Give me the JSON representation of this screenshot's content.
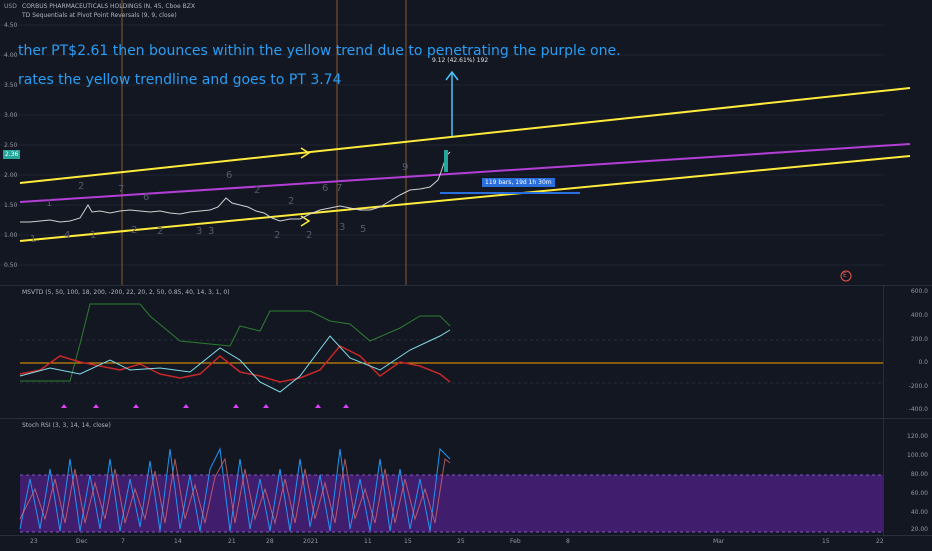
{
  "main": {
    "currency": "USD",
    "title": "CORBUS PHARMACEUTICALS HOLDINGS IN, 45, Cboe BZX",
    "indicator": "TD Sequentials at Pivot Point Reversals (9, 9, close)",
    "note1": "ther PT$2.61 then bounces within the yellow trend due to penetrating the purple one.",
    "note2": "rates the yellow trendline and goes to  PT 3.74",
    "left_ticks": [
      "4.50",
      "4.00",
      "3.50",
      "3.00",
      "2.50",
      "2.00",
      "1.50",
      "1.00",
      "0.50"
    ],
    "price_tag": "2.36",
    "measure_label": "9.12 (42.61%) 192",
    "bars_label": "119 bars, 19d 1h 30m",
    "e_marker": "E",
    "td_counts": [
      {
        "t": "1"
      },
      {
        "t": "2"
      },
      {
        "t": "7"
      },
      {
        "t": "6"
      },
      {
        "t": "6"
      },
      {
        "t": "2"
      },
      {
        "t": "6"
      },
      {
        "t": "7"
      },
      {
        "t": "9"
      },
      {
        "t": "1"
      },
      {
        "t": "4"
      },
      {
        "t": "1"
      },
      {
        "t": "2"
      },
      {
        "t": "2"
      },
      {
        "t": "3"
      },
      {
        "t": "3"
      },
      {
        "t": "2"
      },
      {
        "t": "2"
      },
      {
        "t": "3"
      },
      {
        "t": "5"
      },
      {
        "t": "2"
      }
    ]
  },
  "ind1": {
    "legend": "MSVTD (5, 50, 100, 18, 200, -200, 22, 20, 2, 50, 0.85, 40, 14, 3, 1, 0)",
    "ticks": [
      "600.0",
      "400.0",
      "200.0",
      "0.0",
      "-200.0",
      "-400.0"
    ]
  },
  "ind2": {
    "legend": "Stoch RSI (3, 3, 14, 14, close)",
    "ticks": [
      "120.00",
      "100.00",
      "80.00",
      "60.00",
      "40.00",
      "20.00"
    ]
  },
  "xaxis": {
    "labels": [
      "23",
      "Dec",
      "7",
      "14",
      "21",
      "28",
      "2021",
      "11",
      "15",
      "25",
      "Feb",
      "8",
      "Mar",
      "15",
      "22"
    ]
  },
  "colors": {
    "background": "#131722",
    "yellow": "#ffeb3b",
    "purple": "#b43fd6",
    "note": "#2a9df4",
    "teal": "#26a69a",
    "stoch_band": "#4a1f7a"
  }
}
